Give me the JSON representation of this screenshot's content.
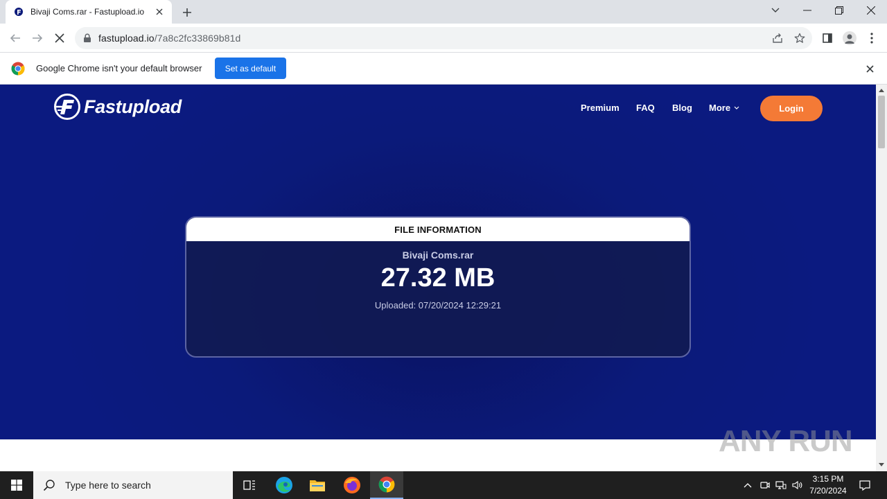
{
  "browser": {
    "tab_title": "Bivaji Coms.rar - Fastupload.io",
    "url_host": "fastupload.io",
    "url_path": "/7a8c2fc33869b81d",
    "infobar_message": "Google Chrome isn't your default browser",
    "infobar_button": "Set as default"
  },
  "site": {
    "logo_text": "Fastupload",
    "nav": {
      "premium": "Premium",
      "faq": "FAQ",
      "blog": "Blog",
      "more": "More",
      "login": "Login"
    },
    "colors": {
      "background": "#0b1a7a",
      "login": "#f47a36"
    }
  },
  "file_card": {
    "heading": "FILE INFORMATION",
    "file_name": "Bivaji Coms.rar",
    "file_size": "27.32 MB",
    "uploaded": "Uploaded: 07/20/2024 12:29:21"
  },
  "watermark": "ANY RUN",
  "taskbar": {
    "search_placeholder": "Type here to search",
    "time": "3:15 PM",
    "date": "7/20/2024"
  }
}
